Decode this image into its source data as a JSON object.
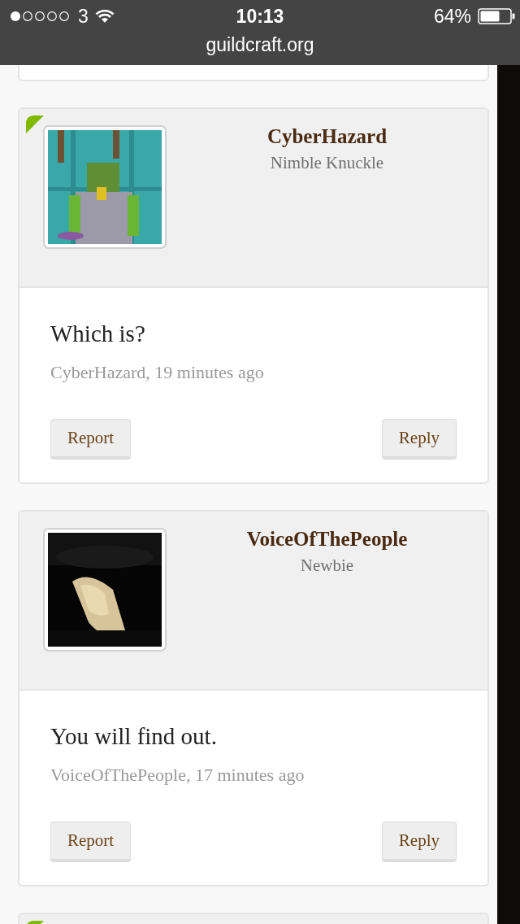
{
  "status_bar": {
    "carrier": "3",
    "time": "10:13",
    "battery": "64%",
    "url": "guildcraft.org"
  },
  "posts": [
    {
      "online": true,
      "avatar": {
        "kind": "picture"
      },
      "author": "CyberHazard",
      "rank": "Nimble Knuckle",
      "message": "Which is?",
      "meta": "CyberHazard, 19 minutes ago",
      "buttons": [
        "Report",
        "Reply"
      ]
    },
    {
      "online": false,
      "avatar": {
        "kind": "picture"
      },
      "author": "VoiceOfThePeople",
      "rank": "Newbie",
      "message": "You will find out.",
      "meta": "VoiceOfThePeople, 17 minutes ago",
      "buttons": [
        "Report",
        "Reply"
      ]
    },
    {
      "online": true
    }
  ]
}
